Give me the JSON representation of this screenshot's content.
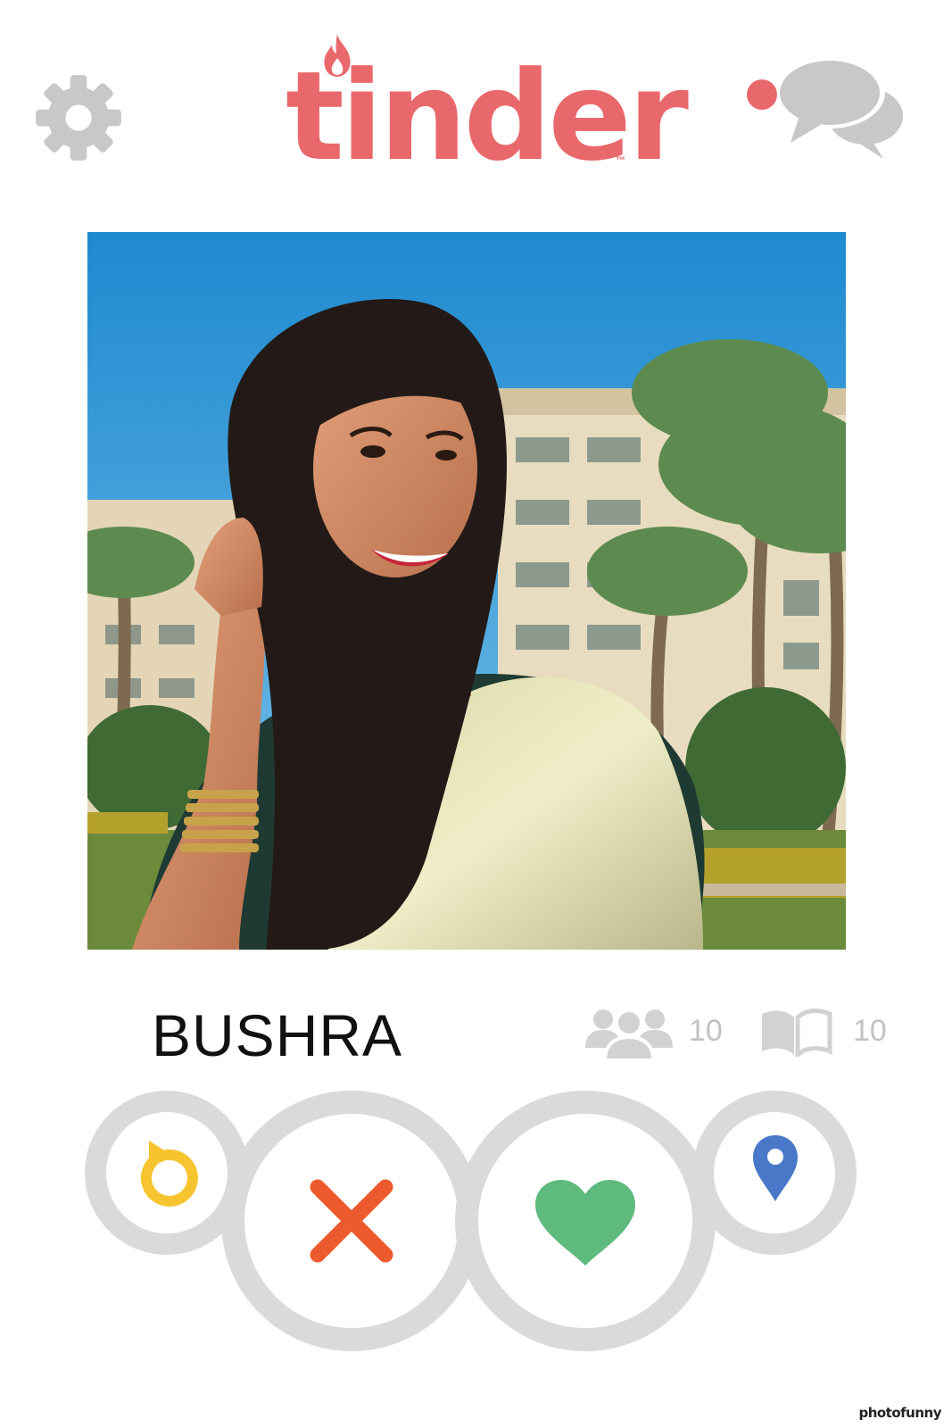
{
  "header": {
    "logo_text": "tinder",
    "logo_tm": "™",
    "brand_color": "#e9686b",
    "settings_icon": "gear-icon",
    "messages_icon": "chat-bubbles-icon",
    "notification_dot": true
  },
  "profile": {
    "name": "BUSHRA",
    "photo_description_icon": "profile-photo",
    "friends_count": "10",
    "interests_count": "10"
  },
  "actions": [
    {
      "name": "rewind",
      "icon": "rewind-icon",
      "color": "#f6c42e"
    },
    {
      "name": "nope",
      "icon": "close-icon",
      "color": "#ec5a2d"
    },
    {
      "name": "like",
      "icon": "heart-icon",
      "color": "#5fba7d"
    },
    {
      "name": "boost",
      "icon": "location-pin-icon",
      "color": "#4a78c8"
    }
  ],
  "watermark": "photofunny",
  "colors": {
    "icon_gray": "#c8c8c8",
    "ring_gray": "#dadada"
  }
}
